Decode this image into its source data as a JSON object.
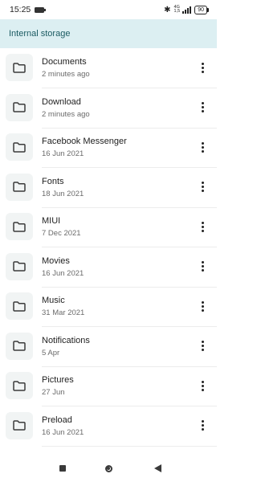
{
  "status_bar": {
    "time": "15:25",
    "network_label": "4G",
    "network_sub": "1,5",
    "battery": "90"
  },
  "header": {
    "title": "Internal storage"
  },
  "folders": [
    {
      "name": "Documents",
      "date": "2 minutes ago"
    },
    {
      "name": "Download",
      "date": "2 minutes ago"
    },
    {
      "name": "Facebook Messenger",
      "date": "16 Jun 2021"
    },
    {
      "name": "Fonts",
      "date": "18 Jun 2021"
    },
    {
      "name": "MIUI",
      "date": "7 Dec 2021"
    },
    {
      "name": "Movies",
      "date": "16 Jun 2021"
    },
    {
      "name": "Music",
      "date": "31 Mar 2021"
    },
    {
      "name": "Notifications",
      "date": "5 Apr"
    },
    {
      "name": "Pictures",
      "date": "27 Jun"
    },
    {
      "name": "Preload",
      "date": "16 Jun 2021"
    }
  ],
  "icons": {
    "folder": "folder-icon",
    "more": "more-vert-icon",
    "bluetooth": "bluetooth-icon",
    "signal": "signal-icon",
    "battery": "battery-icon"
  },
  "colors": {
    "header_bg": "#dceff2",
    "header_text": "#1b5b62",
    "folder_tile": "#f1f4f4"
  }
}
